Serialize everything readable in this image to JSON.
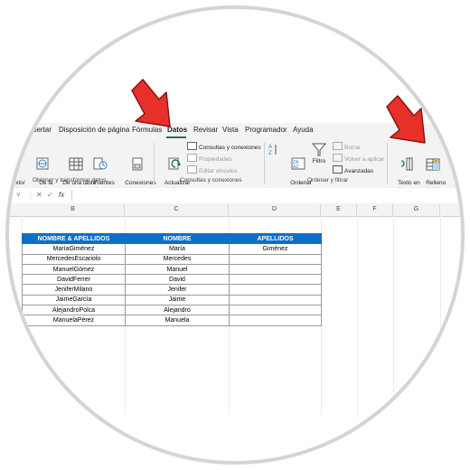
{
  "ribbon": {
    "tabs": [
      {
        "label": "nsertar"
      },
      {
        "label": "Disposición de página"
      },
      {
        "label": "Fórmulas"
      },
      {
        "label": "Datos",
        "active": true
      },
      {
        "label": "Revisar"
      },
      {
        "label": "Vista"
      },
      {
        "label": "Programador"
      },
      {
        "label": "Ayuda"
      }
    ],
    "get_data": {
      "from_csv": "xto/\nSV",
      "from_web": "De la\nweb",
      "from_table": "De una tabla\no rango",
      "recent_sources": "Fuentes\nrecientes",
      "existing_connections": "Conexiones\nexistentes",
      "group_label": "Obtener y transformar datos"
    },
    "queries": {
      "refresh_all": "Actualizar\ntodo ˅",
      "queries_connections": "Consultas y conexiones",
      "properties": "Propiedades",
      "edit_links": "Editar vínculos",
      "group_label": "Consultas y conexiones"
    },
    "sort_filter": {
      "sort": "Ordenar",
      "filter": "Filtro",
      "clear": "Borrar",
      "reapply": "Volver a aplicar",
      "advanced": "Avanzadas",
      "group_label": "Ordenar y filtrar"
    },
    "data_tools": {
      "text_to_columns": "Texto en\ncolumnas",
      "flash_fill": "Relleno\nrápido"
    }
  },
  "formula_bar": {
    "name_box_arrow": "˅",
    "cancel": "✕",
    "enter": "✓",
    "fx": "fx",
    "value": ""
  },
  "columns": [
    "B",
    "C",
    "D",
    "E",
    "F",
    "G"
  ],
  "table": {
    "headers": [
      "NOMBRE & APELLIDOS",
      "NOMBRE",
      "APELLIDOS"
    ],
    "rows": [
      [
        "MaríaGiménez",
        "María",
        "Giménez"
      ],
      [
        "MercedesEscariolo",
        "Mercedes",
        ""
      ],
      [
        "ManuelGómez",
        "Manuel",
        ""
      ],
      [
        "DavidFerrer",
        "David",
        ""
      ],
      [
        "JeniferMilano",
        "Jenifer",
        ""
      ],
      [
        "JaimeGarcía",
        "Jaime",
        ""
      ],
      [
        "AlejandroPolca",
        "Alejandro",
        ""
      ],
      [
        "ManuelaPérez",
        "Manuela",
        ""
      ]
    ]
  },
  "colors": {
    "header_blue": "#0f6fc6",
    "arrow_red": "#e8302a",
    "excel_green": "#1e7145"
  }
}
